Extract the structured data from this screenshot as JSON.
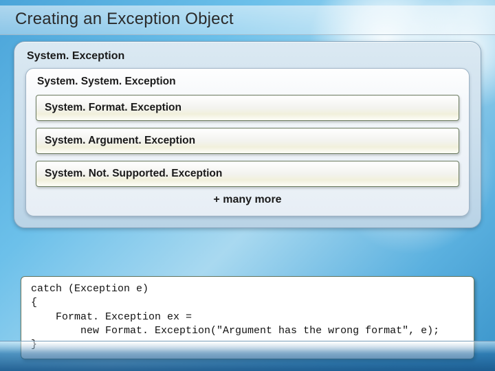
{
  "title": "Creating an Exception Object",
  "panel": {
    "label": "System. Exception",
    "sub": {
      "label": "System. System. Exception",
      "rows": [
        "System. Format. Exception",
        "System. Argument. Exception",
        "System. Not. Supported. Exception"
      ],
      "more": "+ many more"
    }
  },
  "code": "catch (Exception e)\n{\n    Format. Exception ex =\n        new Format. Exception(\"Argument has the wrong format\", e);\n}"
}
